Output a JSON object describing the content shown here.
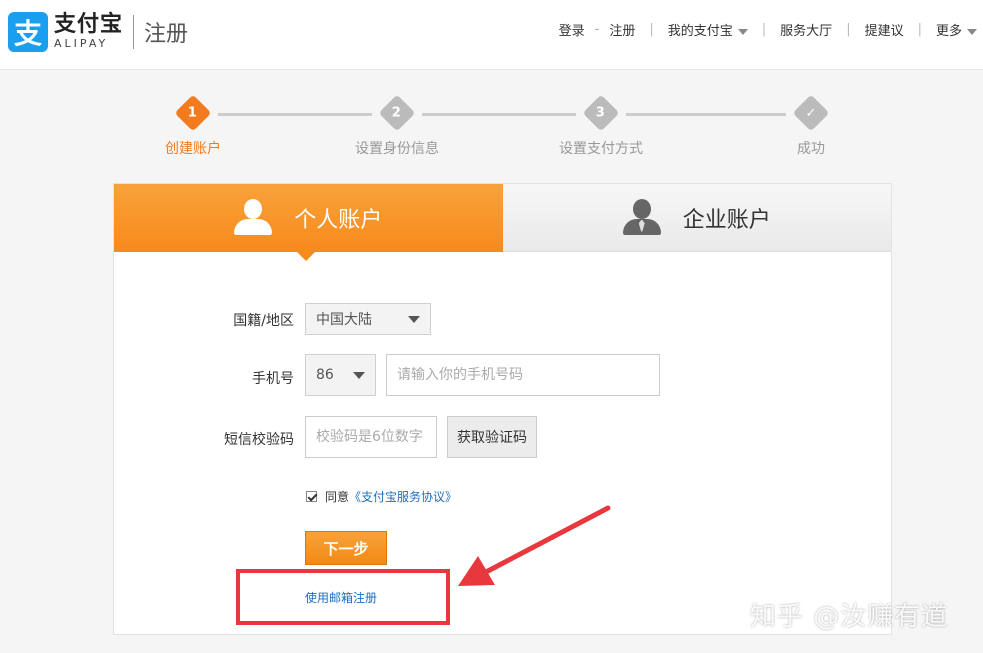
{
  "header": {
    "logo_mark": "支",
    "logo_cn": "支付宝",
    "logo_en": "ALIPAY",
    "page_title": "注册",
    "nav": {
      "login": "登录",
      "register": "注册",
      "my_alipay": "我的支付宝",
      "service_hall": "服务大厅",
      "suggest": "提建议",
      "more": "更多"
    }
  },
  "steps": [
    {
      "num": "1",
      "label": "创建账户",
      "active": true
    },
    {
      "num": "2",
      "label": "设置身份信息",
      "active": false
    },
    {
      "num": "3",
      "label": "设置支付方式",
      "active": false
    },
    {
      "num": "✓",
      "label": "成功",
      "active": false
    }
  ],
  "tabs": {
    "personal": "个人账户",
    "business": "企业账户"
  },
  "form": {
    "nationality_label": "国籍/地区",
    "nationality_value": "中国大陆",
    "phone_label": "手机号",
    "country_code": "86",
    "phone_placeholder": "请输入你的手机号码",
    "sms_label": "短信校验码",
    "sms_placeholder": "校验码是6位数字",
    "get_code": "获取验证码",
    "agree_text": "同意",
    "agreement_link": "《支付宝服务协议》",
    "next": "下一步",
    "email_register": "使用邮箱注册"
  },
  "watermark": "知乎 @汝赚有道",
  "colors": {
    "accent": "#f78a1c",
    "link": "#1a6fc0",
    "highlight": "#e8383d",
    "brand": "#1a9ff0"
  }
}
